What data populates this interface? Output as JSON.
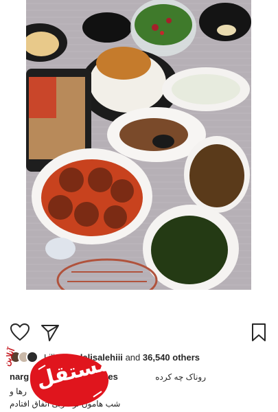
{
  "post": {
    "likes": {
      "prefix_user": "Lili",
      "liked_by": "seyedalisalehiii",
      "and_text": "and",
      "count": "36,540",
      "others": "others"
    },
    "caption": {
      "username": "narg",
      "second_handle": "charges",
      "line1": "روناک چه کرده",
      "line2": "رها و",
      "line3": "شب هامون تو عربی اتفاق افتادم"
    }
  },
  "watermark": {
    "stamp_text": "مستقل",
    "side_text": "آنلاین"
  },
  "icons": {
    "like": "heart-icon",
    "share": "paper-plane-icon",
    "save": "bookmark-icon"
  },
  "colors": {
    "stamp_red": "#e0151d",
    "text": "#262626"
  }
}
